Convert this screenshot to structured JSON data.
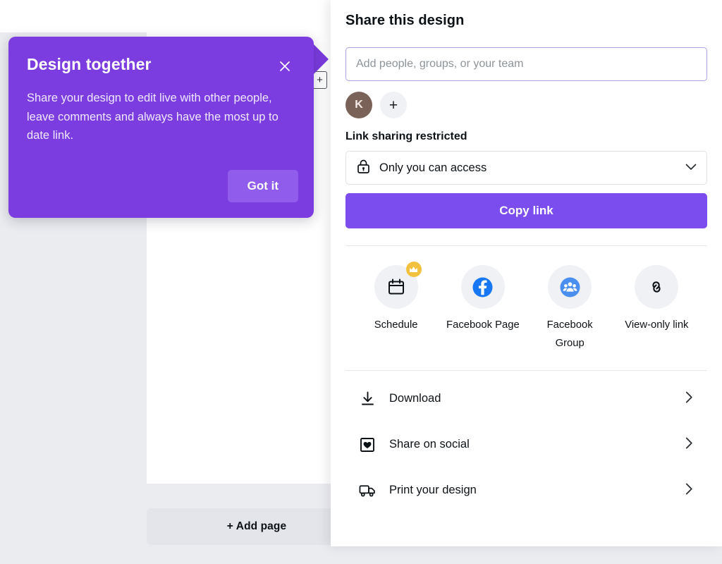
{
  "editor": {
    "add_page_label": "+ Add page",
    "page_plus_icon": "add-page-plus-icon"
  },
  "coachmark": {
    "title": "Design together",
    "body": "Share your design to edit live with other people, leave comments and always have the most up to date link.",
    "cta_label": "Got it",
    "close_icon": "close-icon",
    "background_color": "#7b3ce0",
    "cta_color": "#8f5ceb"
  },
  "share_panel": {
    "title": "Share this design",
    "people_input": {
      "value": "",
      "placeholder": "Add people, groups, or your team"
    },
    "collaborators": [
      {
        "initial": "K",
        "color": "#7b6258"
      }
    ],
    "add_collaborator_label": "+",
    "link_sharing": {
      "label": "Link sharing restricted",
      "selected_option": "Only you can access",
      "lock_icon": "lock-icon",
      "chevron_icon": "chevron-down-icon"
    },
    "copy_link_label": "Copy link",
    "copy_link_color": "#7b4def",
    "quick_share": [
      {
        "label": "Schedule",
        "icon": "calendar-icon",
        "badge": "crown-icon",
        "badge_color": "#f2c13d",
        "icon_color": "#0d1216"
      },
      {
        "label": "Facebook Page",
        "icon": "facebook-icon",
        "badge": null,
        "icon_color": "#1877f2"
      },
      {
        "label": "Facebook Group",
        "icon": "facebook-group-icon",
        "badge": null,
        "icon_color": "#4a8ef0"
      },
      {
        "label": "View-only link",
        "icon": "link-chain-icon",
        "badge": null,
        "icon_color": "#0d1216"
      }
    ],
    "menu_items": [
      {
        "label": "Download",
        "icon": "download-icon",
        "chevron": "chevron-right-icon"
      },
      {
        "label": "Share on social",
        "icon": "heart-square-icon",
        "chevron": "chevron-right-icon"
      },
      {
        "label": "Print your design",
        "icon": "truck-icon",
        "chevron": "chevron-right-icon"
      }
    ]
  }
}
